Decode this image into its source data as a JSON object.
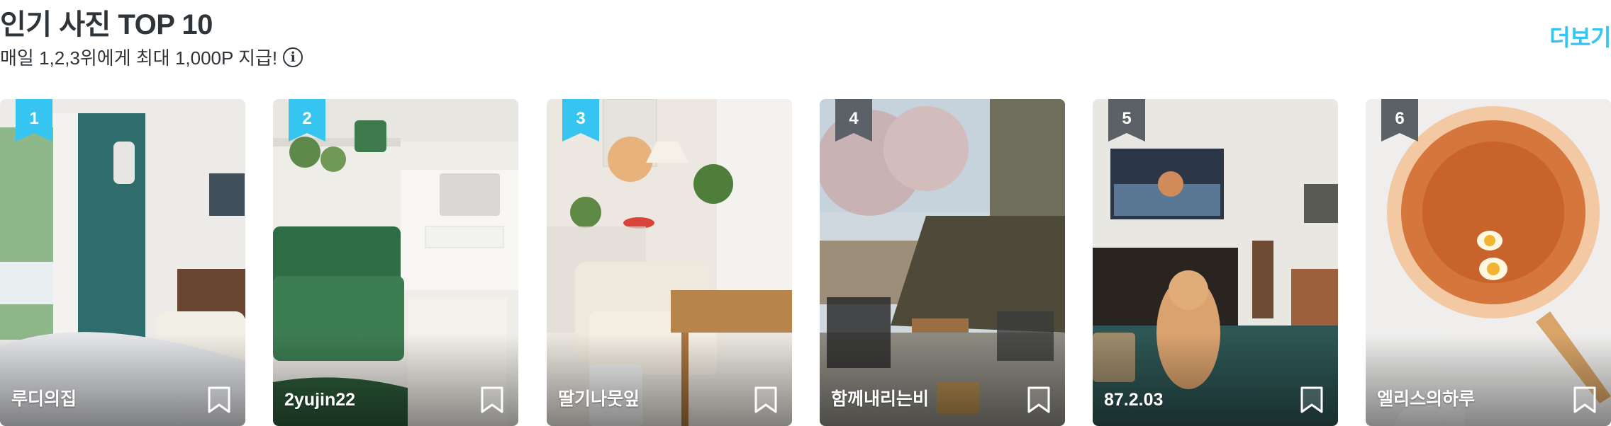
{
  "header": {
    "title": "인기 사진 TOP 10",
    "subtitle": "매일 1,2,3위에게 최대 1,000P 지급!",
    "info_icon": "info-icon",
    "more_label": "더보기"
  },
  "colors": {
    "accent": "#35c5f0",
    "rank_default": "#5c6167",
    "text": "#2f3438"
  },
  "cards": [
    {
      "rank": "1",
      "username": "루디의집",
      "highlighted": true
    },
    {
      "rank": "2",
      "username": "2yujin22",
      "highlighted": true
    },
    {
      "rank": "3",
      "username": "딸기나뭇잎",
      "highlighted": true
    },
    {
      "rank": "4",
      "username": "함께내리는비",
      "highlighted": false
    },
    {
      "rank": "5",
      "username": "87.2.03",
      "highlighted": false
    },
    {
      "rank": "6",
      "username": "엘리스의하루",
      "highlighted": false
    }
  ]
}
